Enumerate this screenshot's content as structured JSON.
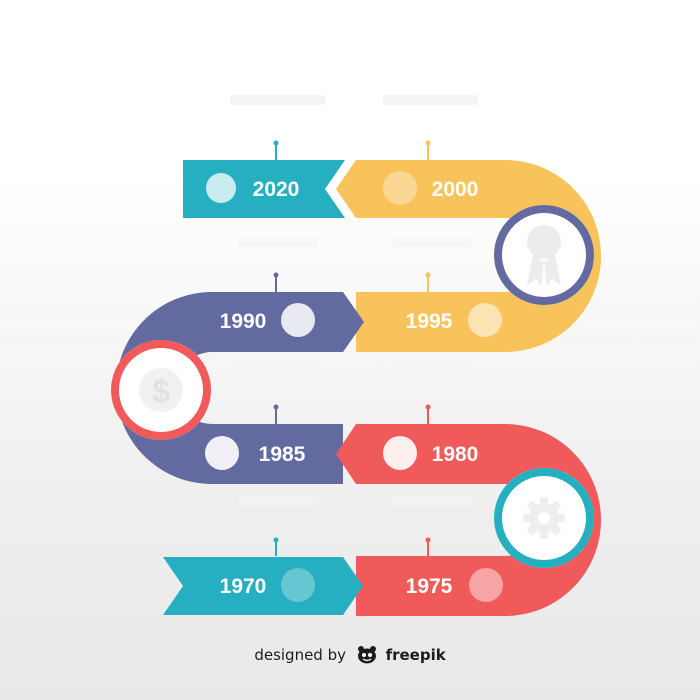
{
  "colors": {
    "teal": "#25afc0",
    "yellow": "#f7c35a",
    "purple": "#636a9f",
    "red": "#f05a5a"
  },
  "milestones": [
    {
      "year": "2020",
      "color": "teal"
    },
    {
      "year": "2000",
      "color": "yellow"
    },
    {
      "year": "1990",
      "color": "purple"
    },
    {
      "year": "1995",
      "color": "yellow"
    },
    {
      "year": "1985",
      "color": "purple"
    },
    {
      "year": "1980",
      "color": "red"
    },
    {
      "year": "1970",
      "color": "teal"
    },
    {
      "year": "1975",
      "color": "red"
    }
  ],
  "turn_icons": [
    {
      "icon": "award-ribbon-icon",
      "color": "purple"
    },
    {
      "icon": "dollar-coin-icon",
      "color": "red"
    },
    {
      "icon": "gear-icon",
      "color": "teal"
    }
  ],
  "credit": {
    "prefix": "designed by",
    "brand": "freepik"
  }
}
